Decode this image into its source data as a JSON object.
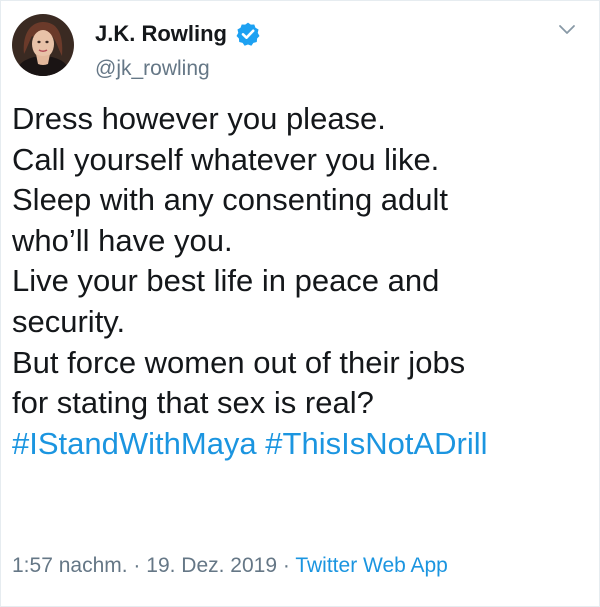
{
  "author": {
    "name": "J.K. Rowling",
    "handle": "@jk_rowling",
    "verified": true
  },
  "tweet": {
    "lines": [
      "Dress however you please.",
      "Call yourself whatever you like.",
      "Sleep with any consenting adult",
      "who’ll have you.",
      "Live your best life in peace and",
      "security.",
      "But force women out of their jobs",
      "for stating that sex is real?"
    ],
    "hashtags": [
      "#IStandWithMaya",
      "#ThisIsNotADrill"
    ]
  },
  "meta": {
    "time": "1:57 nachm.",
    "separator": "·",
    "date": "19. Dez. 2019",
    "source": "Twitter Web App"
  },
  "colors": {
    "text": "#14171a",
    "secondary": "#657786",
    "link": "#1b95e0",
    "verified_badge": "#1da1f2"
  },
  "icons": {
    "verified": "verified-badge-icon",
    "menu": "chevron-down-icon"
  }
}
